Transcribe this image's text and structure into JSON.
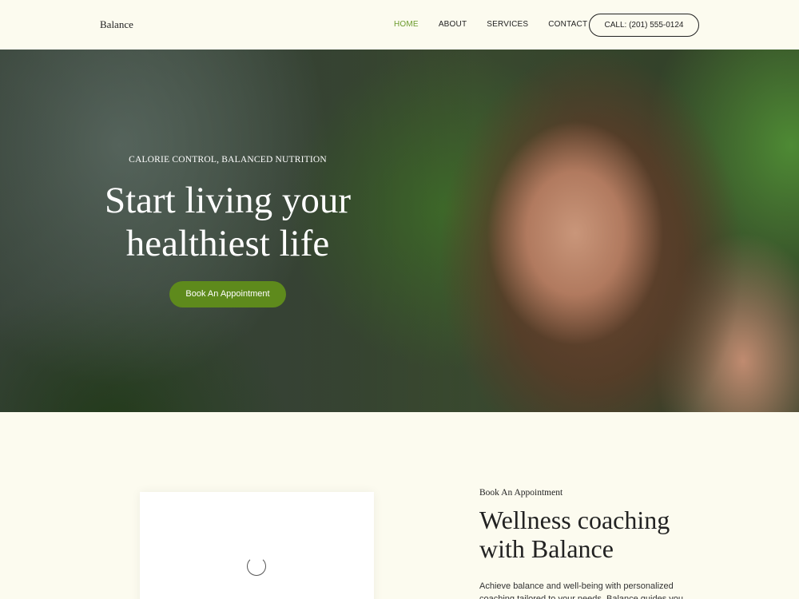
{
  "header": {
    "logo": "Balance",
    "nav": [
      {
        "label": "HOME",
        "active": true
      },
      {
        "label": "ABOUT",
        "active": false
      },
      {
        "label": "SERVICES",
        "active": false
      },
      {
        "label": "CONTACT",
        "active": false
      }
    ],
    "call_label": "CALL: (201) 555-0124"
  },
  "hero": {
    "kicker": "CALORIE CONTROL, BALANCED NUTRITION",
    "title_line1": "Start living your",
    "title_line2": "healthiest life",
    "button_label": "Book An Appointment"
  },
  "about": {
    "kicker": "Book An Appointment",
    "title_line1": "Wellness coaching",
    "title_line2": "with Balance",
    "text": "Achieve balance and well-being with personalized coaching tailored to your needs. Balance guides you"
  },
  "colors": {
    "accent": "#6b9a2c",
    "button": "#5e8a1c",
    "background": "#fcfbef"
  },
  "icons": {
    "loading": "loading-spinner-icon"
  }
}
